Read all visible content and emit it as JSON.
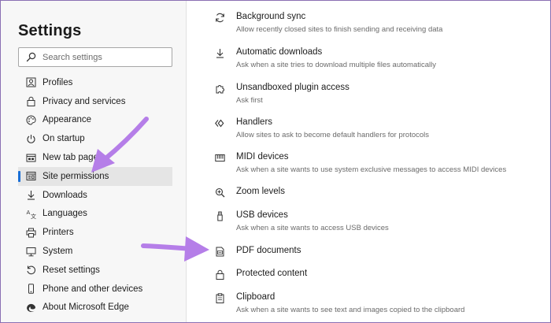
{
  "sidebar": {
    "title": "Settings",
    "search_placeholder": "Search settings",
    "items": [
      {
        "label": "Profiles",
        "icon": "profile-icon"
      },
      {
        "label": "Privacy and services",
        "icon": "lock-icon"
      },
      {
        "label": "Appearance",
        "icon": "palette-icon"
      },
      {
        "label": "On startup",
        "icon": "power-icon"
      },
      {
        "label": "New tab page",
        "icon": "new-tab-icon"
      },
      {
        "label": "Site permissions",
        "icon": "site-permissions-icon",
        "active": true
      },
      {
        "label": "Downloads",
        "icon": "download-icon"
      },
      {
        "label": "Languages",
        "icon": "languages-icon"
      },
      {
        "label": "Printers",
        "icon": "printer-icon"
      },
      {
        "label": "System",
        "icon": "system-icon"
      },
      {
        "label": "Reset settings",
        "icon": "reset-icon"
      },
      {
        "label": "Phone and other devices",
        "icon": "phone-icon"
      },
      {
        "label": "About Microsoft Edge",
        "icon": "edge-icon"
      }
    ]
  },
  "permissions": [
    {
      "title": "Background sync",
      "desc": "Allow recently closed sites to finish sending and receiving data",
      "icon": "sync-icon"
    },
    {
      "title": "Automatic downloads",
      "desc": "Ask when a site tries to download multiple files automatically",
      "icon": "download-icon"
    },
    {
      "title": "Unsandboxed plugin access",
      "desc": "Ask first",
      "icon": "puzzle-icon"
    },
    {
      "title": "Handlers",
      "desc": "Allow sites to ask to become default handlers for protocols",
      "icon": "handlers-icon"
    },
    {
      "title": "MIDI devices",
      "desc": "Ask when a site wants to use system exclusive messages to access MIDI devices",
      "icon": "midi-icon"
    },
    {
      "title": "Zoom levels",
      "desc": "",
      "icon": "zoom-icon"
    },
    {
      "title": "USB devices",
      "desc": "Ask when a site wants to access USB devices",
      "icon": "usb-icon"
    },
    {
      "title": "PDF documents",
      "desc": "",
      "icon": "pdf-icon"
    },
    {
      "title": "Protected content",
      "desc": "",
      "icon": "lock-icon"
    },
    {
      "title": "Clipboard",
      "desc": "Ask when a site wants to see text and images copied to the clipboard",
      "icon": "clipboard-icon"
    }
  ],
  "colors": {
    "accent": "#1a6fd6",
    "annotation_arrow": "#b57ee8",
    "sidebar_bg": "#f7f7f7",
    "active_bg": "#e5e5e5"
  }
}
